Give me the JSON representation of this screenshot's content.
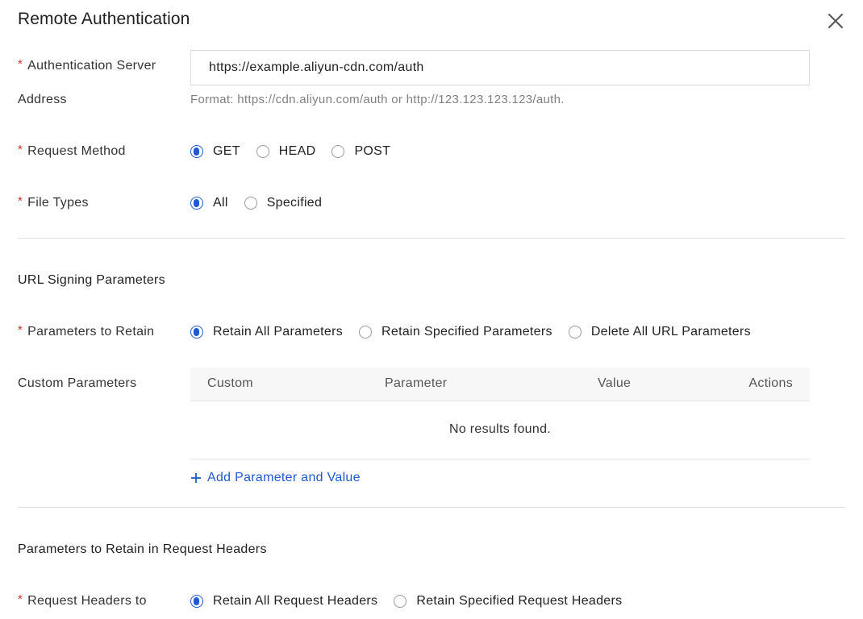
{
  "dialog": {
    "title": "Remote Authentication",
    "close_icon": "close-icon"
  },
  "auth_server": {
    "label_line1": "Authentication Server",
    "label_line2": "Address",
    "value": "https://example.aliyun-cdn.com/auth",
    "help": "Format: https://cdn.aliyun.com/auth or http://123.123.123.123/auth."
  },
  "request_method": {
    "label": "Request Method",
    "options": [
      "GET",
      "HEAD",
      "POST"
    ],
    "selected": "GET"
  },
  "file_types": {
    "label": "File Types",
    "options": [
      "All",
      "Specified"
    ],
    "selected": "All"
  },
  "url_signing": {
    "section_title": "URL Signing Parameters",
    "retain": {
      "label": "Parameters to Retain",
      "options": [
        "Retain All Parameters",
        "Retain Specified Parameters",
        "Delete All URL Parameters"
      ],
      "selected": "Retain All Parameters"
    },
    "custom": {
      "label": "Custom Parameters",
      "columns": [
        "Custom",
        "Parameter",
        "Value",
        "Actions"
      ],
      "rows": [],
      "empty_text": "No results found.",
      "add_label": "Add Parameter and Value",
      "add_icon": "plus-icon"
    }
  },
  "request_headers": {
    "section_title": "Parameters to Retain in Request Headers",
    "label": "Request Headers to",
    "options": [
      "Retain All Request Headers",
      "Retain Specified Request Headers"
    ],
    "selected": "Retain All Request Headers"
  },
  "colors": {
    "accent": "#1f5ad1",
    "required": "#d93026",
    "help_text": "#808080",
    "divider": "#dedede"
  }
}
